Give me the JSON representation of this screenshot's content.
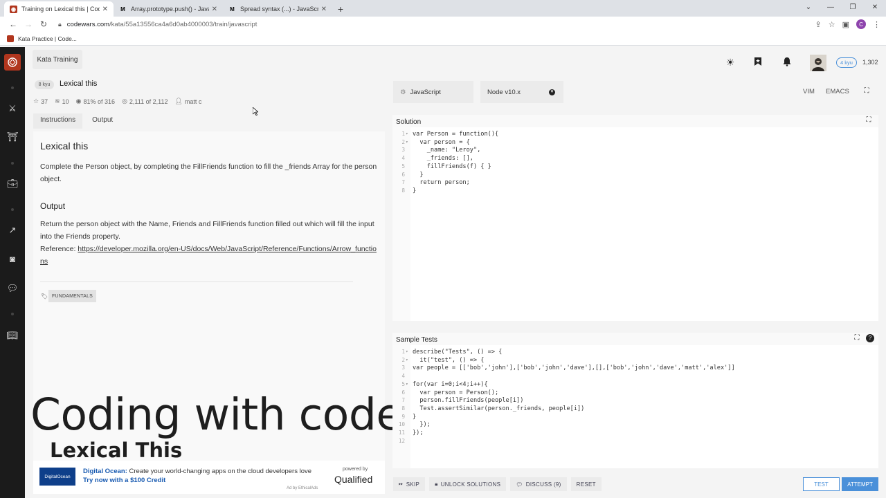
{
  "browser": {
    "tabs": [
      {
        "title": "Training on Lexical this | Codewa",
        "icon": "codewars-icon",
        "active": true
      },
      {
        "title": "Array.prototype.push() - JavaScri",
        "icon": "mdn-icon",
        "active": false
      },
      {
        "title": "Spread syntax (...) - JavaScript | M",
        "icon": "mdn-icon",
        "active": false
      }
    ],
    "url_host": "codewars.com",
    "url_path": "/kata/55a13556ca4a6d0ab4000003/train/javascript",
    "profile_initial": "C",
    "bookmark": "Kata Practice | Code..."
  },
  "header": {
    "kata_training": "Kata Training",
    "rank": "4 kyu",
    "honor": "1,302"
  },
  "kata": {
    "kyu": "8 kyu",
    "title": "Lexical this",
    "stars": "37",
    "collections": "10",
    "satisfaction": "81% of 316",
    "completed": "2,111 of 2,112",
    "author": "matt c"
  },
  "desc_tabs": [
    "Instructions",
    "Output"
  ],
  "description": {
    "heading": "Lexical this",
    "intro": "Complete the Person object, by completing the FillFriends function to fill the _friends Array for the person object.",
    "output_heading": "Output",
    "output_text": "Return the person object with the Name, Friends and FillFriends function filled out which will fill the input into the Friends property.",
    "reference_label": "Reference: ",
    "reference_link": "https://developer.mozilla.org/en-US/docs/Web/JavaScript/Reference/Functions/Arrow_functions",
    "tag": "FUNDAMENTALS"
  },
  "overlay": {
    "line1": "Coding with codeManS",
    "line2": "Lexical This"
  },
  "ad": {
    "logo": "DigitalOcean",
    "brand": "Digital Ocean:",
    "text": " Create your world-changing apps on the cloud developers love ",
    "cta": "Try now with a $100 Credit",
    "by": "Ad by EthicalAds",
    "powered_by": "powered by",
    "qualified": "Qualified"
  },
  "editor_bar": {
    "language": "JavaScript",
    "runtime": "Node v10.x",
    "vim": "VIM",
    "emacs": "EMACS"
  },
  "solution": {
    "title": "Solution",
    "lines": [
      "var Person = function(){",
      "  var person = {",
      "    _name: \"Leroy\",",
      "    _friends: [],",
      "    fillFriends(f) { }",
      "  }",
      "  return person;",
      "}"
    ],
    "folds": [
      1,
      2
    ]
  },
  "tests": {
    "title": "Sample Tests",
    "lines": [
      "describe(\"Tests\", () => {",
      "  it(\"test\", () => {",
      "var people = [['bob','john'],['bob','john','dave'],[],['bob','john','dave','matt','alex']]",
      "",
      "for(var i=0;i<4;i++){",
      "  var person = Person();",
      "  person.fillFriends(people[i])",
      "  Test.assertSimilar(person._friends, people[i])",
      "}",
      "  });",
      "});",
      ""
    ],
    "folds": [
      1,
      2,
      5
    ]
  },
  "footer": {
    "skip": "SKIP",
    "unlock": "UNLOCK SOLUTIONS",
    "discuss": "DISCUSS (9)",
    "reset": "RESET",
    "test": "TEST",
    "attempt": "ATTEMPT"
  },
  "colors": {
    "brand": "#b1361e",
    "accent": "#4a90d9",
    "sidebar": "#1b1b1b"
  }
}
